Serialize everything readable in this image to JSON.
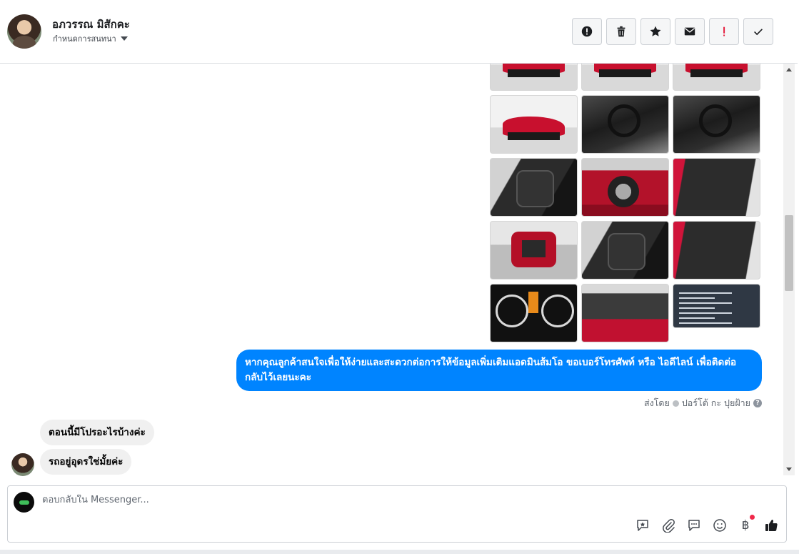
{
  "header": {
    "contact_name": "อภวรรณ มิสักคะ",
    "conversation_status": "กำหนดการสนทนา",
    "actions": [
      {
        "name": "report-button",
        "icon": "exclamation-circle-icon"
      },
      {
        "name": "delete-button",
        "icon": "trash-icon"
      },
      {
        "name": "star-button",
        "icon": "star-icon"
      },
      {
        "name": "mark-unread-button",
        "icon": "envelope-icon"
      },
      {
        "name": "priority-button",
        "icon": "exclamation-icon"
      },
      {
        "name": "done-button",
        "icon": "check-icon"
      }
    ]
  },
  "thread": {
    "outgoing_message": "หากคุณลูกค้าสนใจเพื่อให้ง่ายและสะดวกต่อการให้ข้อมูลเพิ่มเติมแอดมินส้มโอ ขอเบอร์โทรศัพท์ หรือ ไอดีไลน์ เพื่อติดต่อกลับไว้เลยนะคะ",
    "sent_by_prefix": "ส่งโดย",
    "sent_by_name": "ปอร์โต้ กะ ปุยฝ้าย",
    "incoming_messages": [
      "ตอนนี้มีโปรอะไรบ้างค่ะ",
      "รถอยู่อุดรใช่มั้ยค่ะ"
    ],
    "photo_count": 18
  },
  "composer": {
    "placeholder": "ตอบกลับใน Messenger...",
    "tools": [
      "saved-reply-icon",
      "attachment-icon",
      "chat-bubble-icon",
      "emoji-icon",
      "baht-payment-icon",
      "thumbs-up-icon"
    ],
    "payment_glyph": "฿"
  },
  "colors": {
    "outgoing_bubble": "#0084ff",
    "incoming_bubble": "#f0f0f0",
    "priority_red": "#e41e3f",
    "notification_dot": "#f02849"
  }
}
